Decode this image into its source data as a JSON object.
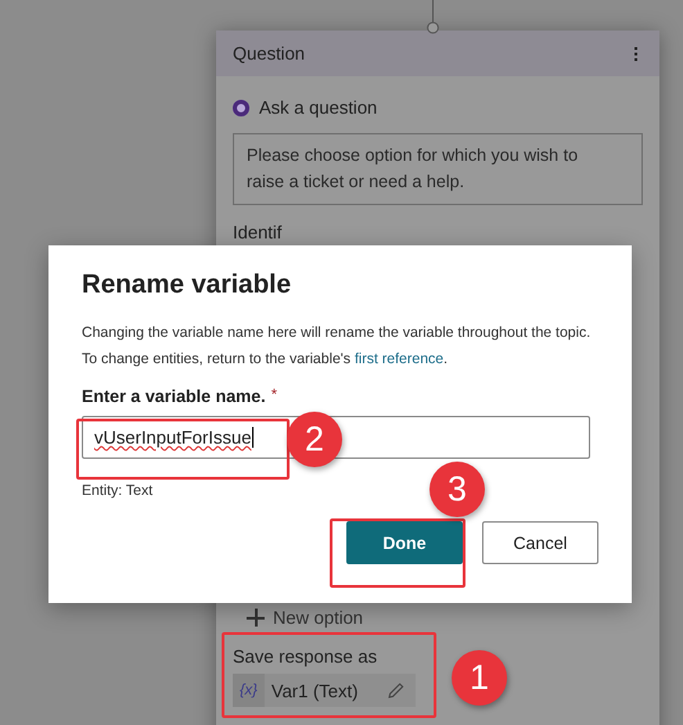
{
  "node": {
    "title": "Question",
    "step_label": "Ask a question",
    "prompt": "Please choose option for which you wish to raise a ticket or need a help.",
    "section_label": "Identif",
    "new_option": "New option",
    "save_label": "Save response as",
    "variable": {
      "token": "{x}",
      "name": "Var1 (Text)"
    }
  },
  "dialog": {
    "title": "Rename variable",
    "description": "Changing the variable name here will rename the variable throughout the topic. To change entities, return to the variable's ",
    "link": "first reference",
    "description_end": ".",
    "field_label": "Enter a variable name.",
    "required_mark": "*",
    "value": "vUserInputForIssue",
    "entity": "Entity: Text",
    "buttons": [
      {
        "label": "Done",
        "kind": "primary"
      },
      {
        "label": "Cancel",
        "kind": "secondary"
      }
    ]
  },
  "callouts": [
    {
      "number": "2"
    },
    {
      "number": "3"
    },
    {
      "number": "1"
    }
  ]
}
